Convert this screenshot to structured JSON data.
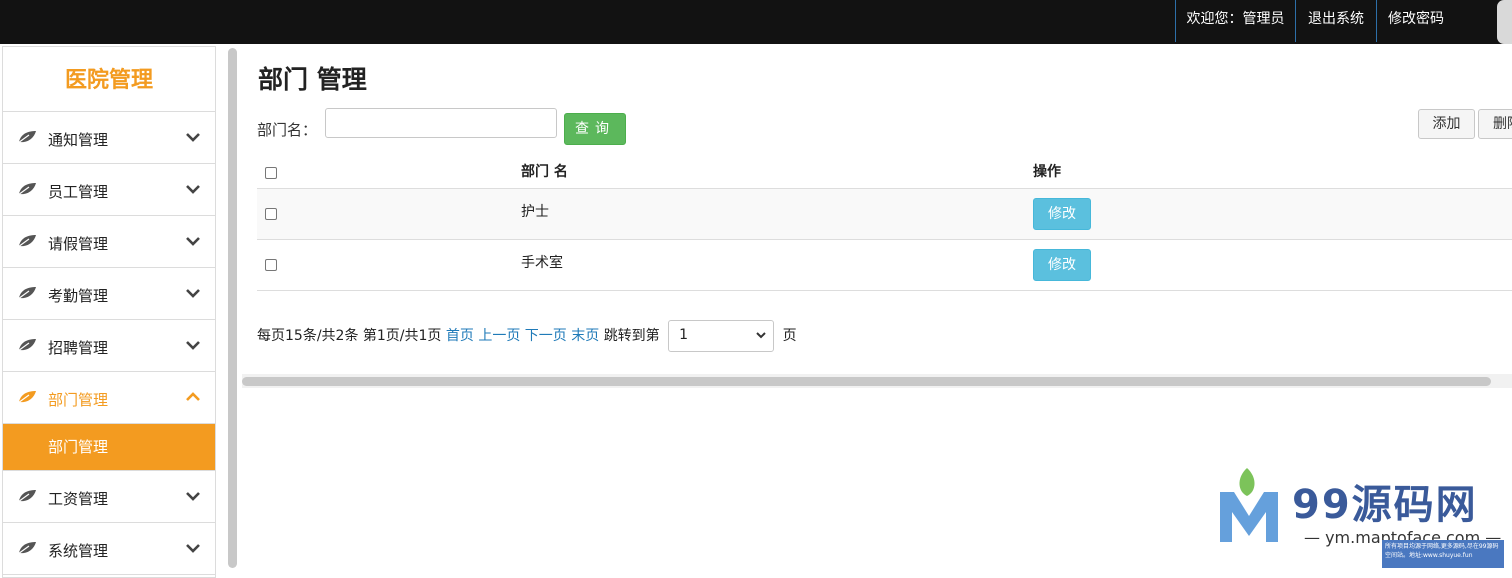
{
  "topbar": {
    "welcome": "欢迎您：管理员",
    "logout": "退出系统",
    "change_password": "修改密码"
  },
  "sidebar": {
    "title": "医院管理",
    "items": [
      {
        "label": "通知管理",
        "expanded": false
      },
      {
        "label": "员工管理",
        "expanded": false
      },
      {
        "label": "请假管理",
        "expanded": false
      },
      {
        "label": "考勤管理",
        "expanded": false
      },
      {
        "label": "招聘管理",
        "expanded": false
      },
      {
        "label": "部门管理",
        "expanded": true
      },
      {
        "label": "工资管理",
        "expanded": false
      },
      {
        "label": "系统管理",
        "expanded": false
      }
    ],
    "sub_item": "部门管理",
    "accent": "#f39b20"
  },
  "main": {
    "title": "部门 管理",
    "search": {
      "label": "部门名：",
      "value": "",
      "button": "查询"
    },
    "actions": {
      "add": "添加",
      "delete": "删除"
    },
    "table": {
      "headers": [
        "部门 名",
        "操作"
      ],
      "rows": [
        {
          "name": "护士",
          "action": "修改"
        },
        {
          "name": "手术室",
          "action": "修改"
        }
      ]
    },
    "pager": {
      "summary": "每页15条/共2条 第1页/共1页",
      "first": "首页",
      "prev": "上一页",
      "next": "下一页",
      "last": "末页",
      "jump_prefix": "跳转到第",
      "page_value": "1",
      "jump_suffix": "页"
    }
  },
  "watermark": {
    "title": "99源码网",
    "url": "— ym.maptoface.com —",
    "note": "所有项目均源于网络,更多源码,尽在99源码空间站。地址:www.shuyue.fun"
  }
}
